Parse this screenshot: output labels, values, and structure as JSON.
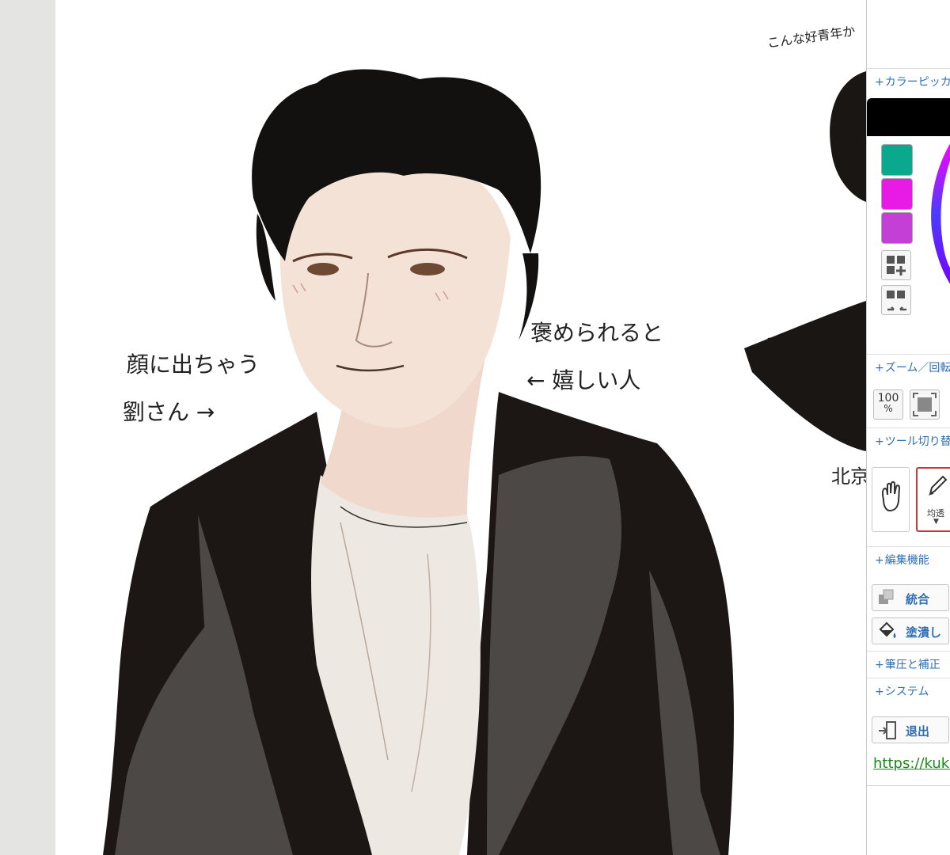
{
  "canvas": {
    "notes": {
      "top_right": "こんな好青年か",
      "left_line1": "顔に出ちゃう",
      "left_line2": "劉さん →",
      "right_line1": "褒められると",
      "right_line2": "← 嬉しい人",
      "far_right": "北京"
    }
  },
  "panel": {
    "sections": {
      "color_picker": "カラーピッカー",
      "zoom_rotate": "ズーム／回転",
      "tool_switch": "ツール切り替え",
      "edit_functions": "編集機能",
      "pressure_correction": "筆圧と補正",
      "system": "システム"
    },
    "plus": "+",
    "current_color": "#000000",
    "swatches": [
      "#0aa88c",
      "#e81ae6",
      "#c43fd6"
    ],
    "zoom_label": "100",
    "zoom_unit": "%",
    "pen_mode": "均透",
    "pen_mode_arrow": "▼",
    "buttons": {
      "merge": "統合",
      "fill": "塗潰し",
      "exit": "退出"
    },
    "url": "https://kuku"
  }
}
